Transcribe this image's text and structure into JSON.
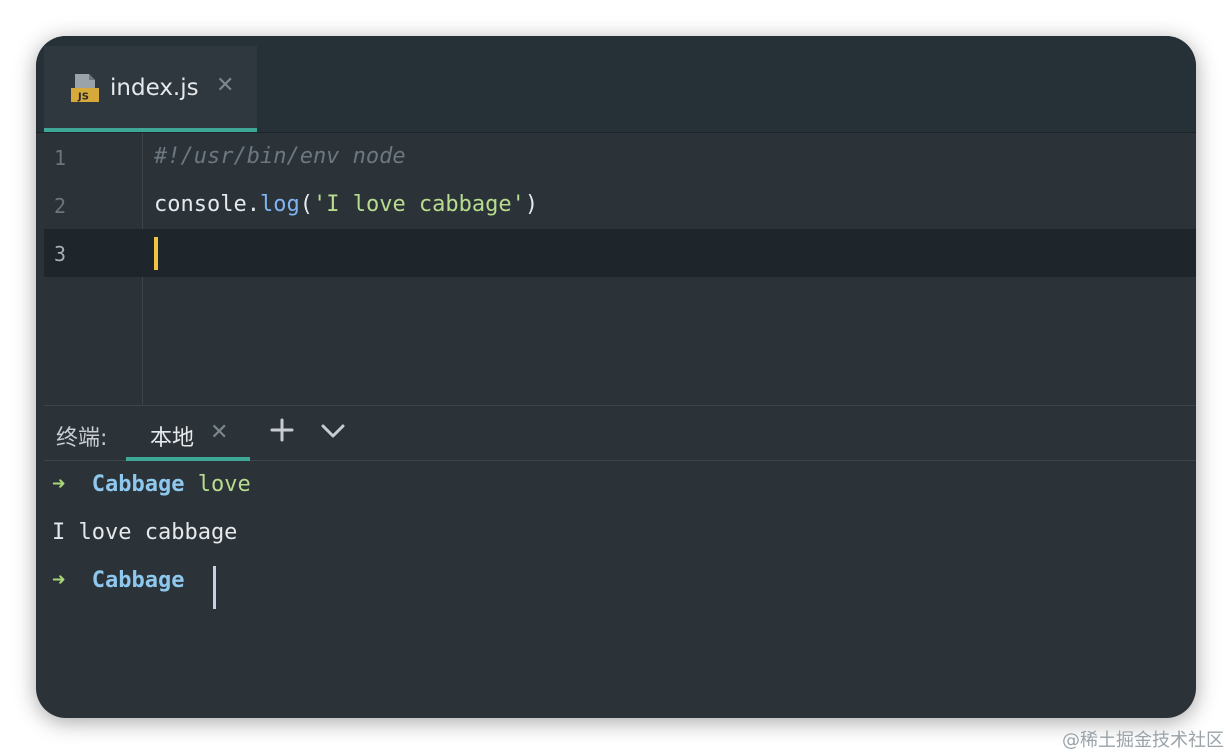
{
  "editor_tab": {
    "icon": "js-file-icon",
    "title": "index.js",
    "close_glyph": "✕"
  },
  "code_lines": [
    {
      "number": "1",
      "text": "#!/usr/bin/env node"
    },
    {
      "number": "2",
      "obj": "console",
      "dot": ".",
      "method": "log",
      "open": "(",
      "string": "'I love cabbage'",
      "close": ")"
    },
    {
      "number": "3",
      "text": ""
    }
  ],
  "terminal": {
    "label": "终端:",
    "tab_label": "本地",
    "tab_close": "✕",
    "lines": [
      {
        "arrow": "➜",
        "dir": "Cabbage",
        "command": "love"
      },
      {
        "output": "I love cabbage"
      },
      {
        "arrow": "➜",
        "dir": "Cabbage"
      }
    ]
  },
  "colors": {
    "accent": "#3fa796",
    "background": "#2b3339",
    "caret": "#f0c341",
    "string": "#b7dc8e",
    "function": "#7fb4f0",
    "dir": "#8ec8ef"
  },
  "watermark": "@稀土掘金技术社区"
}
